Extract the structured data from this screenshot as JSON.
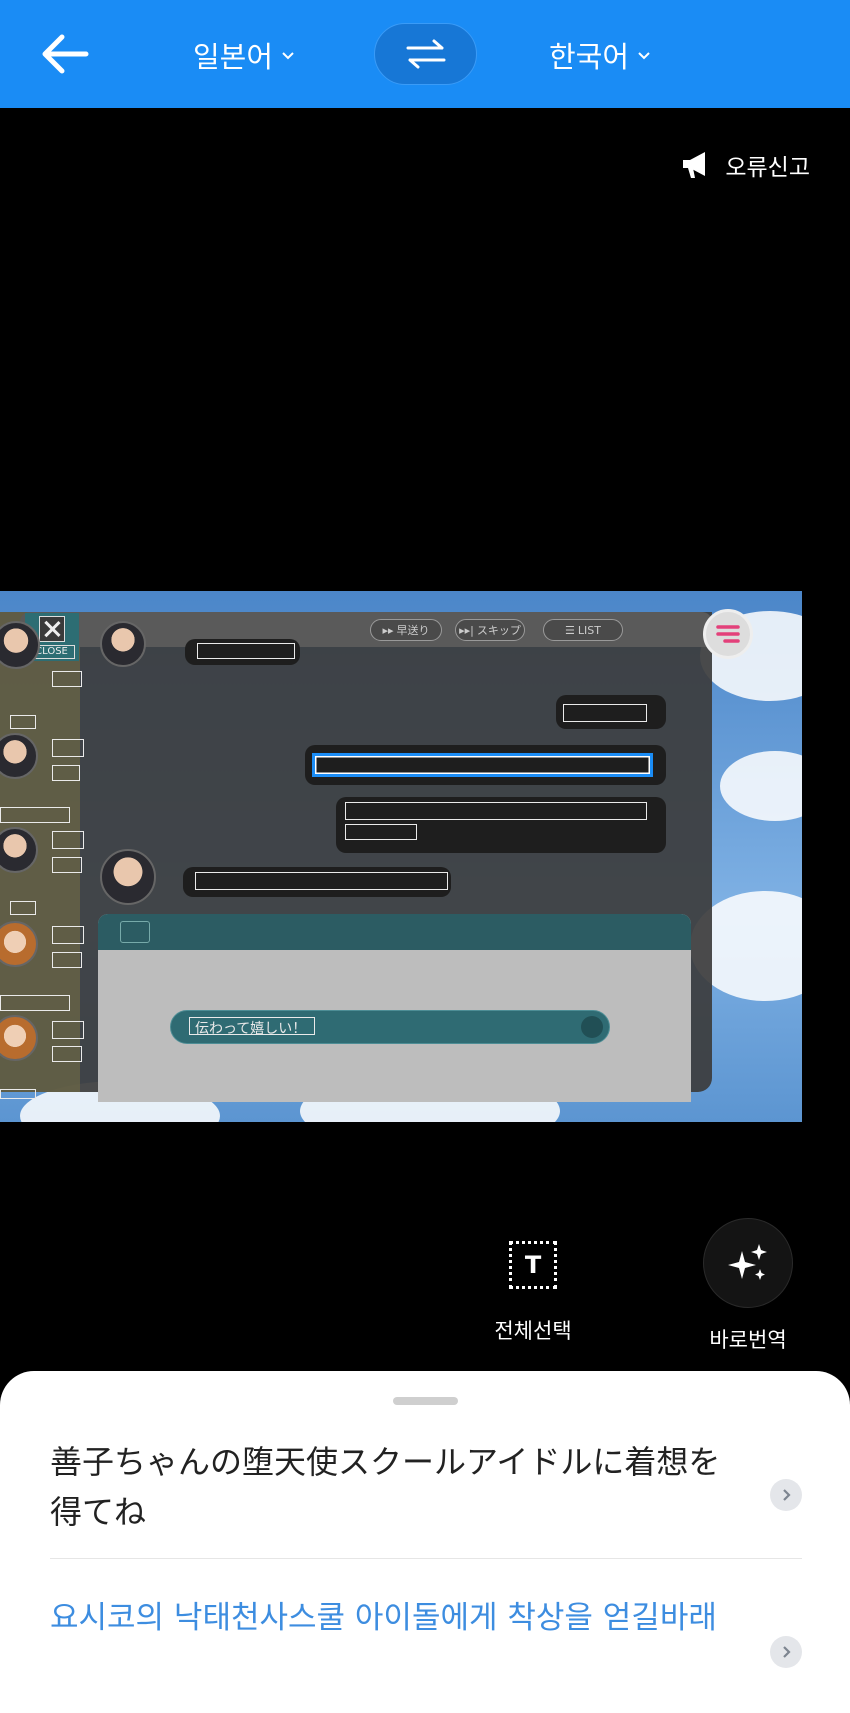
{
  "header": {
    "source_language": "일본어",
    "target_language": "한국어"
  },
  "report_label": "오류신고",
  "game": {
    "close_label": "CLOSE",
    "btn_fast": "早送り",
    "btn_skip": "スキップ",
    "btn_list": "LIST",
    "choice_text": "伝わって嬉しい！"
  },
  "actions": {
    "select_all_label": "전체선택",
    "instant_translate_label": "바로번역"
  },
  "result": {
    "source_text": "善子ちゃんの堕天使スクールアイドルに着想を得てね",
    "translated_text": "요시코의 낙태천사스쿨 아이돌에게 착상을 얻길바래"
  },
  "colors": {
    "topbar": "#1a8cf5",
    "translation": "#3d8de0"
  }
}
